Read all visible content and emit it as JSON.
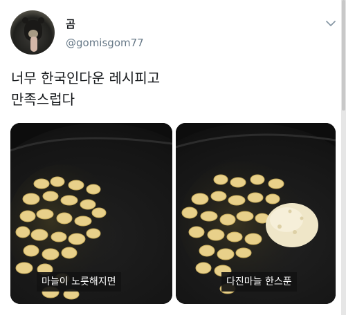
{
  "tweet": {
    "display_name": "곰",
    "handle": "@gomisgom77",
    "text_lines": [
      "너무 한국인다운 레시피고",
      "만족스럽다"
    ],
    "more_icon": "chevron-down-icon",
    "photos": [
      {
        "caption": "마늘이 노릇해지면"
      },
      {
        "caption": "다진마늘 한스푼"
      }
    ]
  },
  "colors": {
    "text": "#14171a",
    "secondary_text": "#657786",
    "pan": "#121212",
    "garlic": "#e8d08a"
  }
}
